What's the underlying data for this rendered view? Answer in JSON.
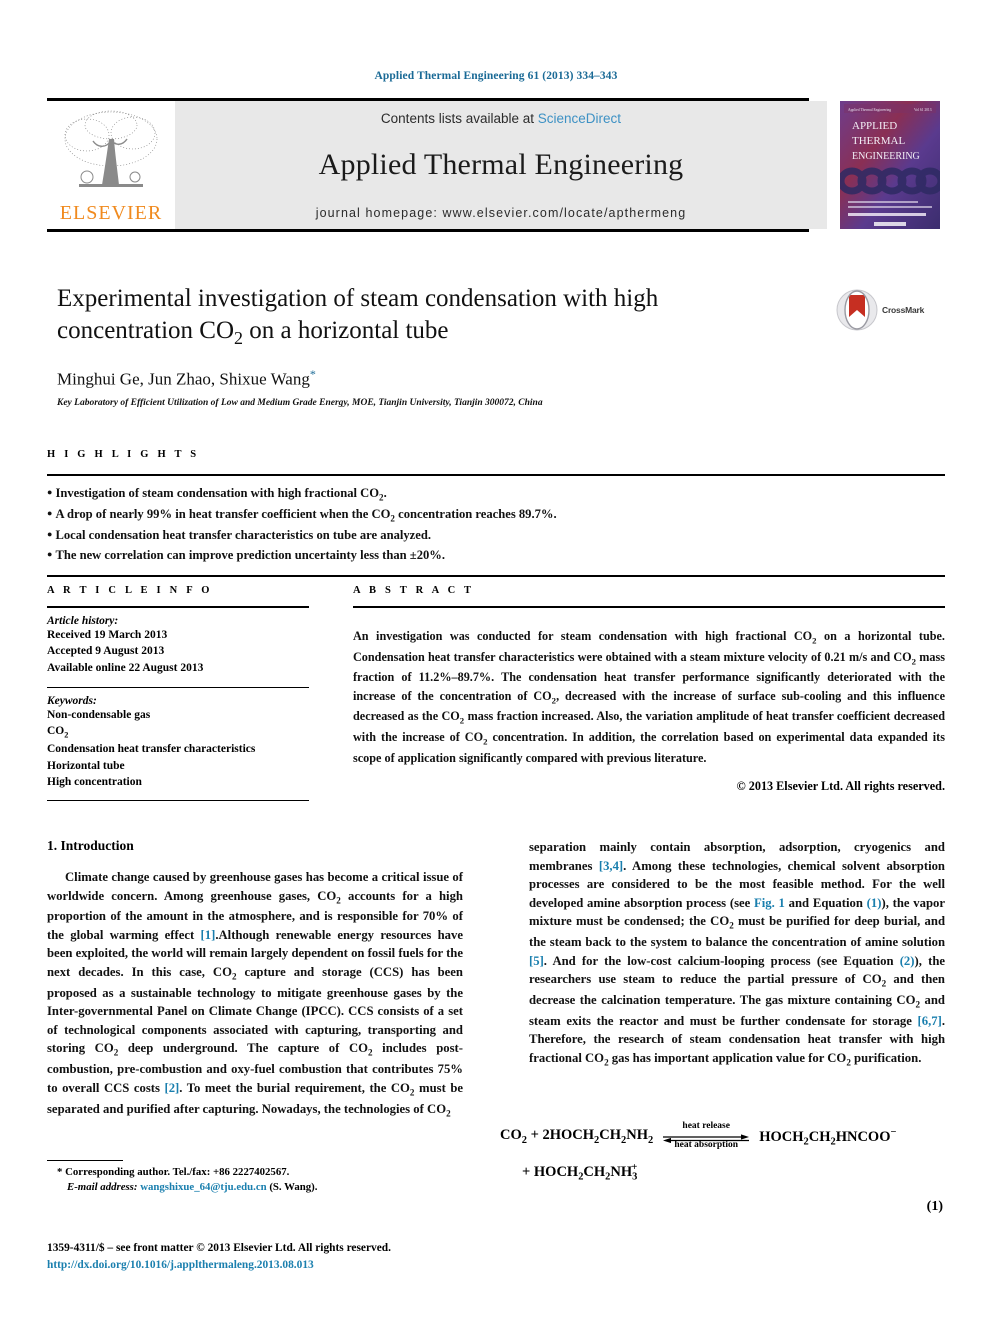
{
  "running_head": "Applied Thermal Engineering 61 (2013) 334–343",
  "masthead": {
    "contents_prefix": "Contents lists available at",
    "sciencedirect": "ScienceDirect",
    "journal_title": "Applied Thermal Engineering",
    "homepage": "journal homepage: www.elsevier.com/locate/apthermeng",
    "publisher": "ELSEVIER",
    "cover": {
      "line1": "APPLIED",
      "line2": "THERMAL",
      "line3": "ENGINEERING"
    },
    "link_color": "#3d91c4"
  },
  "title_block": {
    "title_line1": "Experimental investigation of steam condensation with high",
    "title_line2_a": "concentration CO",
    "title_line2_sub": "2",
    "title_line2_b": " on a horizontal tube",
    "authors": "Minghui Ge, Jun Zhao, Shixue Wang",
    "corresponding_marker": "*",
    "affiliation": "Key Laboratory of Efficient Utilization of Low and Medium Grade Energy, MOE, Tianjin University, Tianjin 300072, China",
    "crossmark_label": "CrossMark"
  },
  "highlights": {
    "heading": "H I G H L I G H T S",
    "items": [
      "Investigation of steam condensation with high fractional CO2.",
      "A drop of nearly 99% in heat transfer coefficient when the CO2 concentration reaches 89.7%.",
      "Local condensation heat transfer characteristics on tube are analyzed.",
      "The new correlation can improve prediction uncertainty less than ±20%."
    ]
  },
  "article_info": {
    "heading": "A R T I C L E   I N F O",
    "history_label": "Article history:",
    "history": [
      "Received 19 March 2013",
      "Accepted 9 August 2013",
      "Available online 22 August 2013"
    ],
    "keywords_label": "Keywords:",
    "keywords": [
      "Non-condensable gas",
      "CO2",
      "Condensation heat transfer characteristics",
      "Horizontal tube",
      "High concentration"
    ]
  },
  "abstract": {
    "heading": "A B S T R A C T",
    "text": "An investigation was conducted for steam condensation with high fractional CO2 on a horizontal tube. Condensation heat transfer characteristics were obtained with a steam mixture velocity of 0.21 m/s and CO2 mass fraction of 11.2%–89.7%. The condensation heat transfer performance significantly deteriorated with the increase of the concentration of CO2, decreased with the increase of surface sub-cooling and this influence decreased as the CO2 mass fraction increased. Also, the variation amplitude of heat transfer coefficient decreased with the increase of CO2 concentration. In addition, the correlation based on experimental data expanded its scope of application significantly compared with previous literature.",
    "copyright": "© 2013 Elsevier Ltd. All rights reserved."
  },
  "body": {
    "section_number_title": "1. Introduction",
    "left_paragraph": "Climate change caused by greenhouse gases has become a critical issue of worldwide concern. Among greenhouse gases, CO2 accounts for a high proportion of the amount in the atmosphere, and is responsible for 70% of the global warming effect [1].Although renewable energy resources have been exploited, the world will remain largely dependent on fossil fuels for the next decades. In this case, CO2 capture and storage (CCS) has been proposed as a sustainable technology to mitigate greenhouse gases by the Inter-governmental Panel on Climate Change (IPCC). CCS consists of a set of technological components associated with capturing, transporting and storing CO2 deep underground. The capture of CO2 includes post-combustion, pre-combustion and oxy-fuel combustion that contributes 75% to overall CCS costs [2]. To meet the burial requirement, the CO2 must be separated and purified after capturing. Nowadays, the technologies of CO2",
    "right_paragraph": "separation mainly contain absorption, adsorption, cryogenics and membranes [3,4]. Among these technologies, chemical solvent absorption processes are considered to be the most feasible method. For the well developed amine absorption process (see Fig. 1 and Equation (1)), the vapor mixture must be condensed; the CO2 must be purified for deep burial, and the steam back to the system to balance the concentration of amine solution [5]. And for the low-cost calcium-looping process (see Equation (2)), the researchers use steam to reduce the partial pressure of CO2 and then decrease the calcination temperature. The gas mixture containing CO2 and steam exits the reactor and must be further condensate for storage [6,7]. Therefore, the research of steam condensation heat transfer with high fractional CO2 gas has important application value for CO2 purification."
  },
  "equation": {
    "left_side": "CO2 + 2HOCH2CH2NH2",
    "arrow_top_label": "heat release",
    "arrow_bottom_label": "heat absorption",
    "right_side": "HOCH2CH2HNCOO−",
    "second_line": "+ HOCH2CH2NH3+",
    "number": "(1)"
  },
  "footnotes": {
    "corresponding_marker": "*",
    "corresponding": "Corresponding author. Tel./fax: +86 2227402567.",
    "email_label": "E-mail address:",
    "email": "wangshixue_64@tju.edu.cn",
    "email_suffix": "(S. Wang).",
    "issn_line": "1359-4311/$ – see front matter © 2013 Elsevier Ltd. All rights reserved.",
    "doi": "http://dx.doi.org/10.1016/j.applthermaleng.2013.08.013"
  }
}
